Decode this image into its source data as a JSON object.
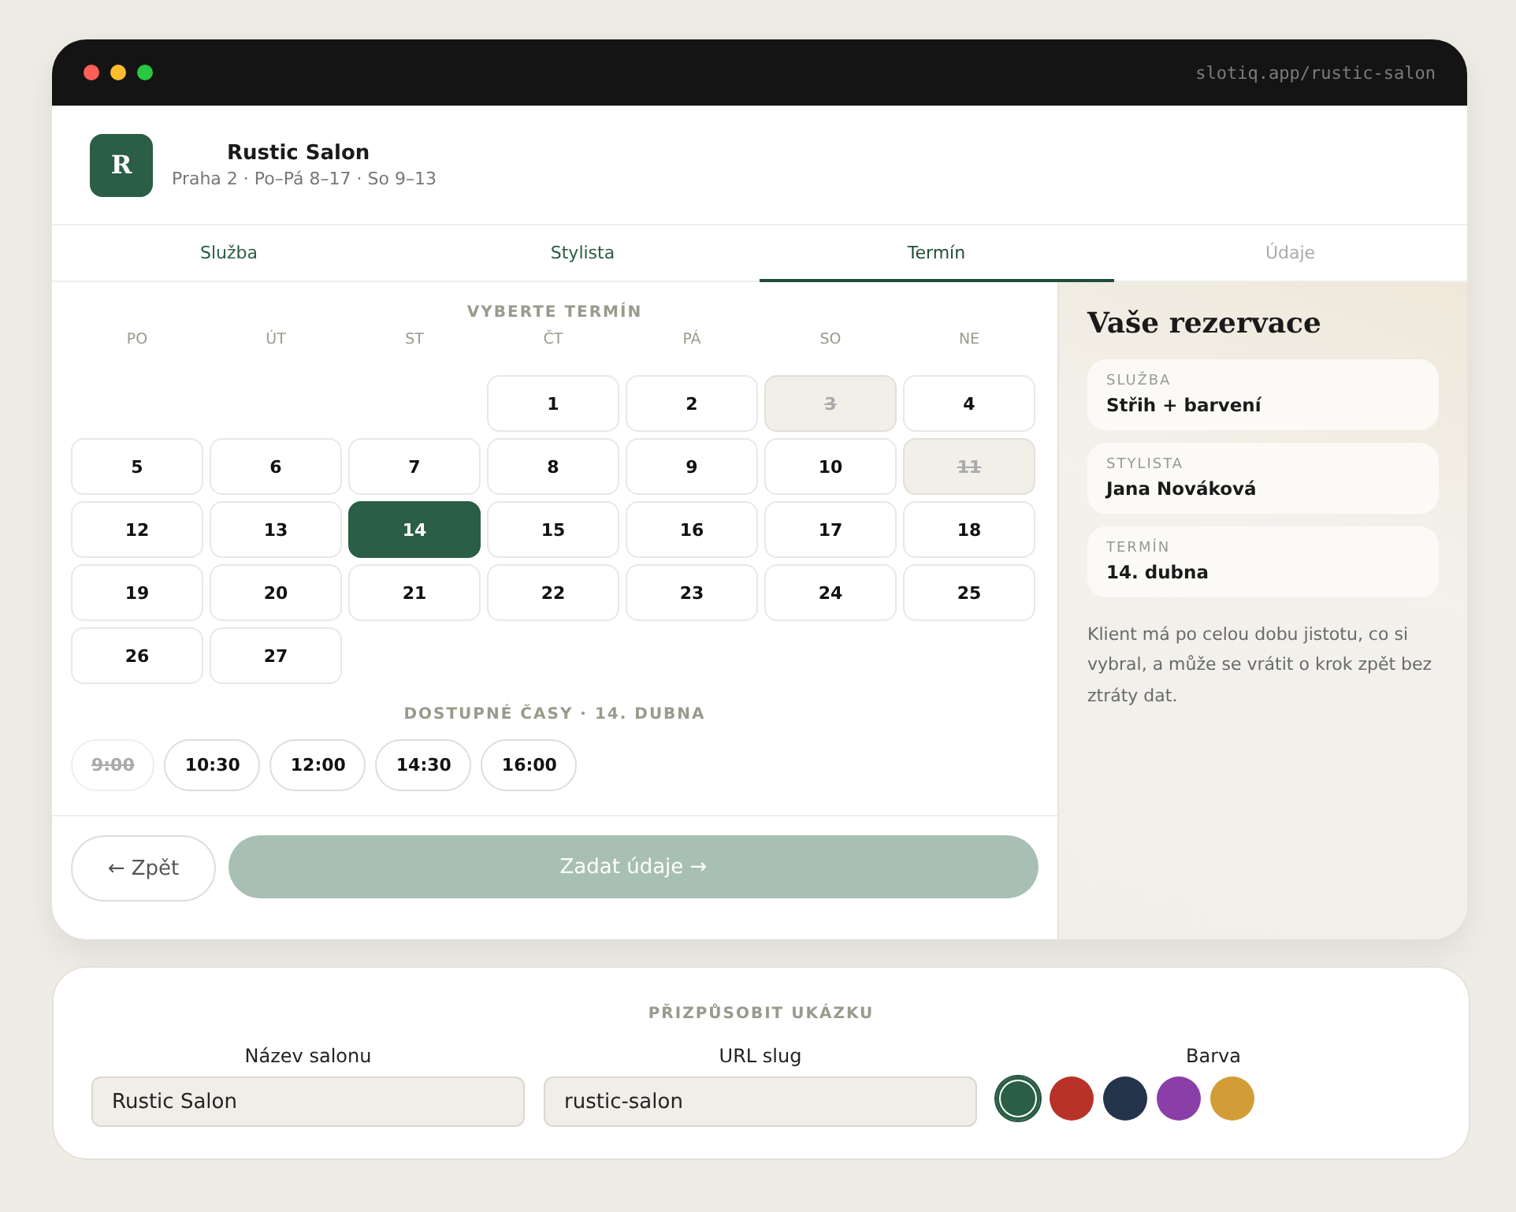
{
  "window": {
    "url": "slotiq.app/rustic-salon"
  },
  "salon": {
    "logo": "R",
    "name": "Rustic Salon",
    "info": "Praha 2 · Po–Pá 8–17 · So 9–13"
  },
  "tabs": [
    {
      "label": "Služba",
      "selected": false,
      "done": true
    },
    {
      "label": "Stylista",
      "selected": false,
      "done": true
    },
    {
      "label": "Termín",
      "selected": true,
      "done": false
    },
    {
      "label": "Údaje",
      "selected": false,
      "done": false
    }
  ],
  "calendar": {
    "heading": "VYBERTE TERMÍN",
    "weekdays": [
      "PO",
      "ÚT",
      "ST",
      "ČT",
      "PÁ",
      "SO",
      "NE"
    ],
    "weeks": [
      {
        "kind": "partial",
        "days": [
          {
            "day": "1",
            "disabled": false,
            "selected": false
          },
          {
            "day": "2",
            "disabled": false,
            "selected": false
          },
          {
            "day": "3",
            "disabled": true,
            "selected": false
          },
          {
            "day": "4",
            "disabled": false,
            "selected": false
          }
        ]
      },
      {
        "kind": "full",
        "days": [
          {
            "day": "5",
            "disabled": false,
            "selected": false
          },
          {
            "day": "6",
            "disabled": false,
            "selected": false
          },
          {
            "day": "7",
            "disabled": false,
            "selected": false
          },
          {
            "day": "8",
            "disabled": false,
            "selected": false
          },
          {
            "day": "9",
            "disabled": false,
            "selected": false
          },
          {
            "day": "10",
            "disabled": false,
            "selected": false
          },
          {
            "day": "11",
            "disabled": true,
            "selected": false
          }
        ]
      },
      {
        "kind": "full",
        "days": [
          {
            "day": "12",
            "disabled": false,
            "selected": false
          },
          {
            "day": "13",
            "disabled": false,
            "selected": false
          },
          {
            "day": "14",
            "disabled": false,
            "selected": true
          },
          {
            "day": "15",
            "disabled": false,
            "selected": false
          },
          {
            "day": "16",
            "disabled": false,
            "selected": false
          },
          {
            "day": "17",
            "disabled": false,
            "selected": false
          },
          {
            "day": "18",
            "disabled": false,
            "selected": false
          }
        ]
      },
      {
        "kind": "full",
        "days": [
          {
            "day": "19",
            "disabled": false,
            "selected": false
          },
          {
            "day": "20",
            "disabled": false,
            "selected": false
          },
          {
            "day": "21",
            "disabled": false,
            "selected": false
          },
          {
            "day": "22",
            "disabled": false,
            "selected": false
          },
          {
            "day": "23",
            "disabled": false,
            "selected": false
          },
          {
            "day": "24",
            "disabled": false,
            "selected": false
          },
          {
            "day": "25",
            "disabled": false,
            "selected": false
          }
        ]
      },
      {
        "kind": "trailing",
        "days": [
          {
            "day": "26",
            "disabled": false,
            "selected": false
          },
          {
            "day": "27",
            "disabled": false,
            "selected": false
          }
        ]
      }
    ]
  },
  "times": {
    "heading": "DOSTUPNÉ ČASY · 14. DUBNA",
    "slots": [
      {
        "label": "9:00",
        "disabled": true
      },
      {
        "label": "10:30",
        "disabled": false
      },
      {
        "label": "12:00",
        "disabled": false
      },
      {
        "label": "14:30",
        "disabled": false
      },
      {
        "label": "16:00",
        "disabled": false
      }
    ]
  },
  "actions": {
    "back": "← Zpět",
    "next": {
      "label": "Zadat údaje →",
      "disabled": true
    }
  },
  "summary": {
    "title": "Vaše rezervace",
    "items": [
      {
        "label": "SLUŽBA",
        "value": "Střih + barvení"
      },
      {
        "label": "STYLISTA",
        "value": "Jana Nováková"
      },
      {
        "label": "TERMÍN",
        "value": "14. dubna"
      }
    ],
    "note": "Klient má po celou dobu jistotu, co si vybral, a může se vrátit o krok zpět bez ztráty dat."
  },
  "customize": {
    "heading": "PŘIZPŮSOBIT UKÁZKU",
    "fields": [
      {
        "label": "Název salonu",
        "value": "Rustic Salon"
      },
      {
        "label": "URL slug",
        "value": "rustic-salon"
      }
    ],
    "color_label": "Barva",
    "colors": [
      {
        "color": "#2a5e45",
        "selected": true
      },
      {
        "color": "#b83227",
        "selected": false
      },
      {
        "color": "#24344a",
        "selected": false
      },
      {
        "color": "#8a3fa8",
        "selected": false
      },
      {
        "color": "#d29d36",
        "selected": false
      }
    ]
  }
}
